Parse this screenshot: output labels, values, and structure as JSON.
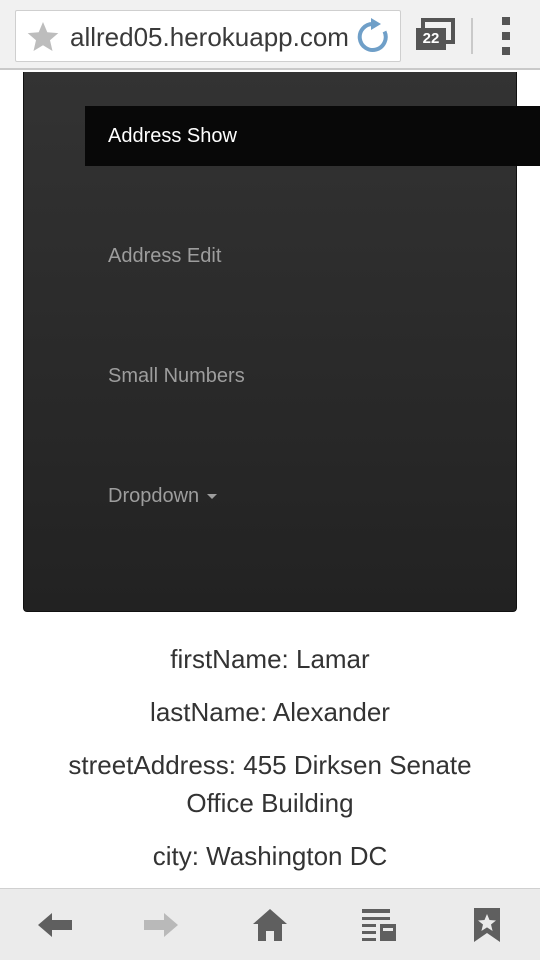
{
  "browser": {
    "url": "allred05.herokuapp.com",
    "tab_count": "22",
    "icons": {
      "star": "star-icon",
      "reload": "reload-icon",
      "tabs": "tabs-icon",
      "menu": "menu-icon"
    },
    "bottom_icons": [
      "back-arrow-icon",
      "forward-arrow-icon",
      "home-icon",
      "reader-icon",
      "bookmarks-icon"
    ]
  },
  "nav": {
    "items": [
      {
        "label": "Address Show",
        "active": true
      },
      {
        "label": "Address Edit",
        "active": false
      },
      {
        "label": "Small Numbers",
        "active": false
      },
      {
        "label": "Dropdown",
        "active": false,
        "has_caret": true
      }
    ]
  },
  "address": {
    "firstName": "firstName: Lamar",
    "lastName": "lastName: Alexander",
    "streetAddress": "streetAddress: 455 Dirksen Senate Office Building",
    "city": "city: Washington DC"
  },
  "colors": {
    "navbar_bg": "#222222",
    "navbar_active_bg": "#080808",
    "navbar_text": "#9d9d9d",
    "navbar_active_text": "#ffffff",
    "reload_blue": "#6f9fc8",
    "body_text": "#333333"
  }
}
